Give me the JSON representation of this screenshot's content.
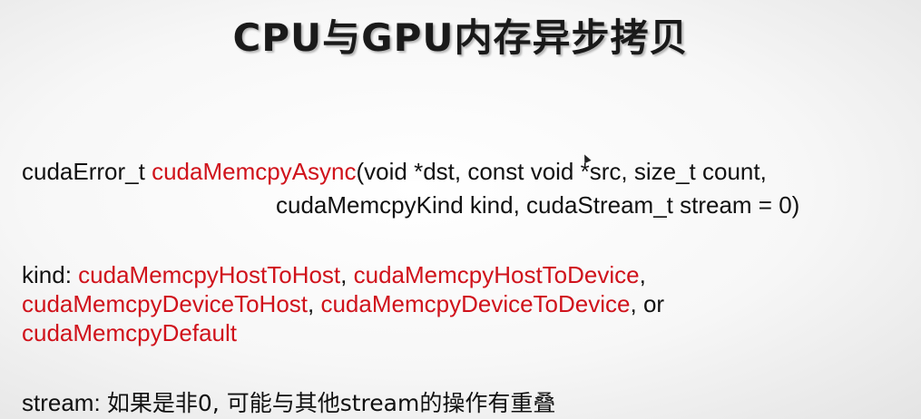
{
  "title": "CPU与GPU内存异步拷贝",
  "signature": {
    "return_type": "cudaError_t ",
    "func_name": "cudaMemcpyAsync",
    "params_line1": "(void *dst, const void *src, size_t count,",
    "params_line2": "cudaMemcpyKind kind, cudaStream_t stream = 0)"
  },
  "kind": {
    "label": "kind: ",
    "values": [
      "cudaMemcpyHostToHost",
      "cudaMemcpyHostToDevice",
      "cudaMemcpyDeviceToHost",
      "cudaMemcpyDeviceToDevice",
      "cudaMemcpyDefault"
    ],
    "sep": ", ",
    "sep_end": ",",
    "or_text": ", or"
  },
  "stream": {
    "label": "stream: ",
    "description": "如果是非0, 可能与其他stream的操作有重叠"
  },
  "colors": {
    "highlight": "#d0121b",
    "text": "#111111"
  }
}
